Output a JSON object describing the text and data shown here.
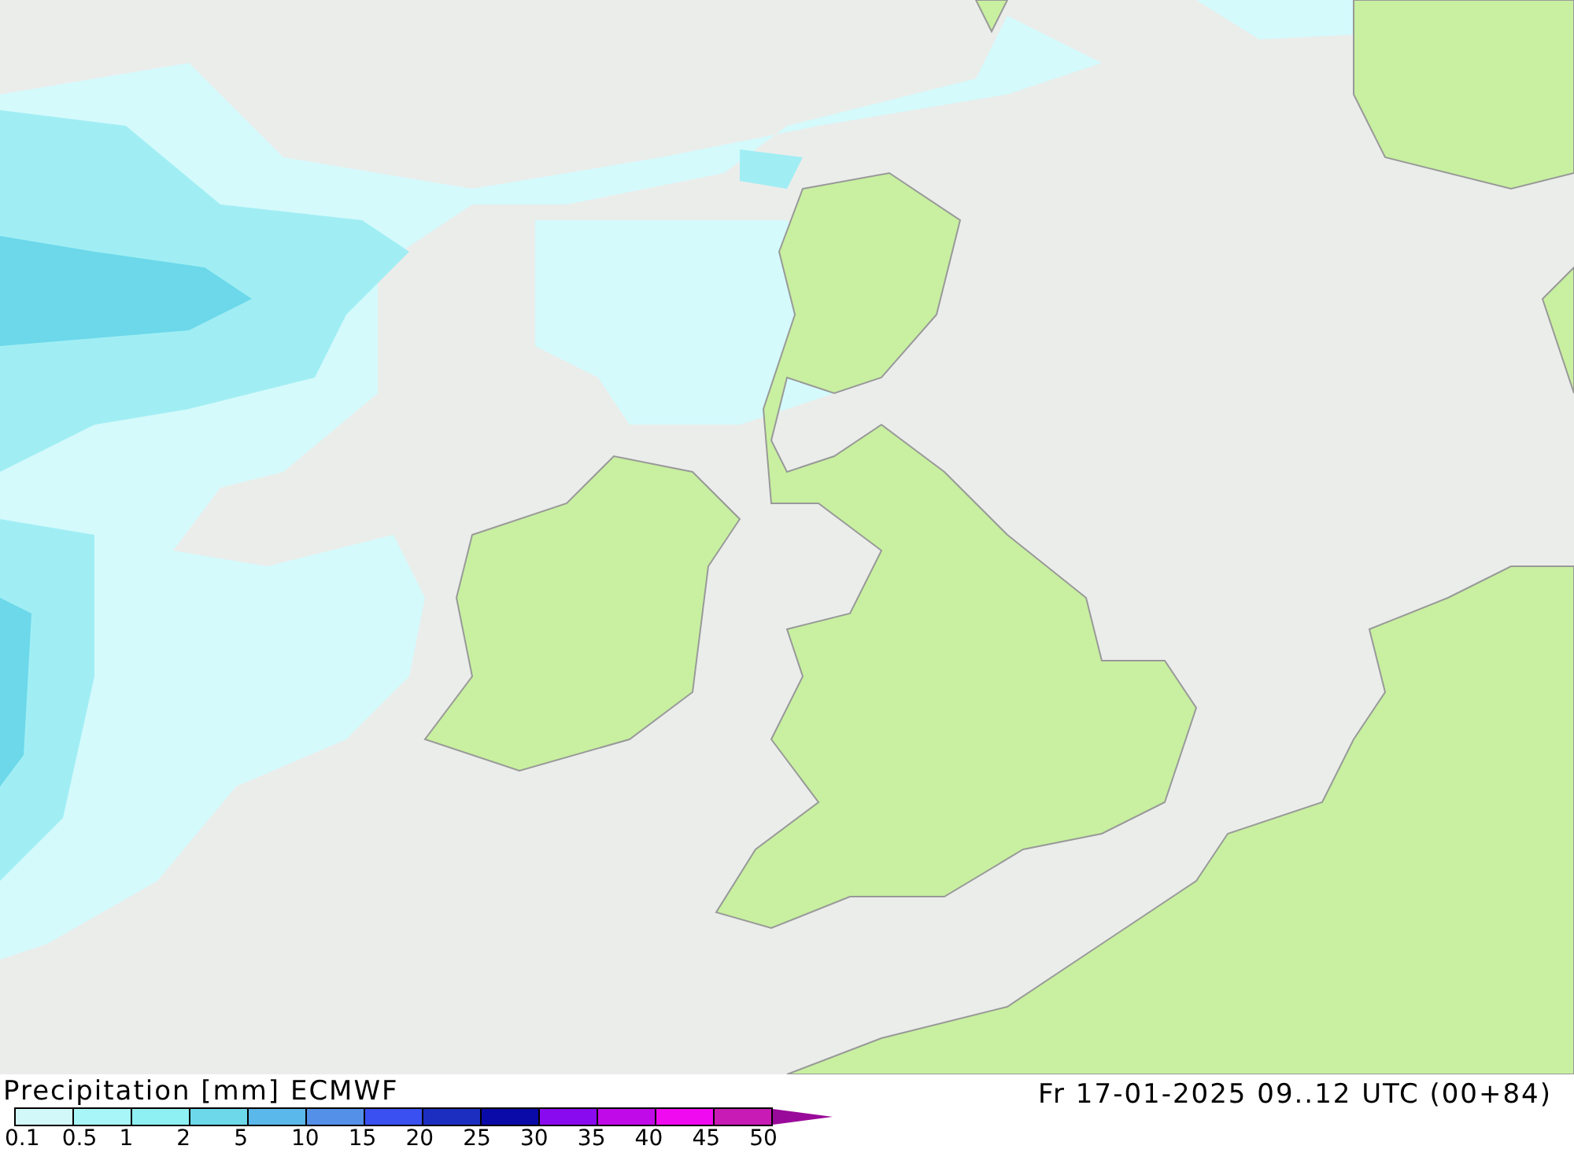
{
  "title": "Precipitation [mm] ECMWF",
  "valid_time": "Fr 17-01-2025 09..12 UTC (00+84)",
  "legend": {
    "bins": [
      {
        "color": "#d2f8fa"
      },
      {
        "color": "#a8f6f8"
      },
      {
        "color": "#8ef0f2"
      },
      {
        "color": "#6cd8ea"
      },
      {
        "color": "#5ab8ea"
      },
      {
        "color": "#5590e8"
      },
      {
        "color": "#3a50f0"
      },
      {
        "color": "#1c2ec0"
      },
      {
        "color": "#0a0aa8"
      },
      {
        "color": "#8a0af0"
      },
      {
        "color": "#c00ae8"
      },
      {
        "color": "#f00af0"
      },
      {
        "color": "#c81ab4"
      }
    ],
    "ticks": [
      "0.1",
      "0.5",
      "1",
      "2",
      "5",
      "10",
      "15",
      "20",
      "25",
      "30",
      "35",
      "40",
      "45",
      "50"
    ]
  }
}
